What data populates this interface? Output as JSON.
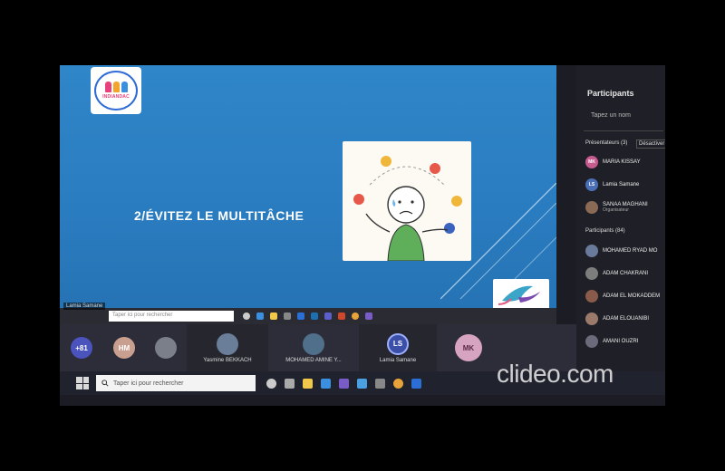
{
  "slide": {
    "title": "2/ÉVITEZ LE MULTITÂCHE",
    "logo_text": "INDIANDAC"
  },
  "inner_taskbar": {
    "presenter": "Lamia Samane",
    "search_placeholder": "Taper ici pour rechercher"
  },
  "video_strip": {
    "overflow_count": "+81",
    "tiles": [
      {
        "initials": "HM",
        "name": ""
      },
      {
        "initials": "",
        "name": ""
      },
      {
        "initials": "",
        "name": "Yasmine BEKKACH"
      },
      {
        "initials": "",
        "name": "MOHAMED AMINE Y..."
      },
      {
        "initials": "LS",
        "name": "Lamia Samane"
      },
      {
        "initials": "MK",
        "name": ""
      }
    ]
  },
  "taskbar": {
    "search_placeholder": "Taper ici pour rechercher"
  },
  "panel": {
    "title": "Participants",
    "search_placeholder": "Tapez un nom",
    "presenters_label": "Présentateurs (3)",
    "mute_all_label": "Désactiver l",
    "presenters": [
      {
        "initials": "MK",
        "name": "MARIA KISSAY",
        "role": "",
        "color": "#c65b8f"
      },
      {
        "initials": "LS",
        "name": "Lamia Samane",
        "role": "",
        "color": "#4a6fb5"
      },
      {
        "initials": "",
        "name": "SANAA MAGHANI",
        "role": "Organisateur",
        "color": "#8a6a55"
      }
    ],
    "attendees_label": "Participants (84)",
    "attendees": [
      {
        "name": "MOHAMED RYAD MO",
        "color": "#6a7a9a"
      },
      {
        "name": "ADAM CHAKRANI",
        "color": "#7d7d7d"
      },
      {
        "name": "ADAM EL MOKADDEM",
        "color": "#8a5a4a"
      },
      {
        "name": "ADAM ELOUANIBI",
        "color": "#9a7a6a"
      },
      {
        "name": "AMANI OUZRI",
        "color": "#6a6a7a"
      }
    ]
  },
  "watermark": "clideo.com"
}
